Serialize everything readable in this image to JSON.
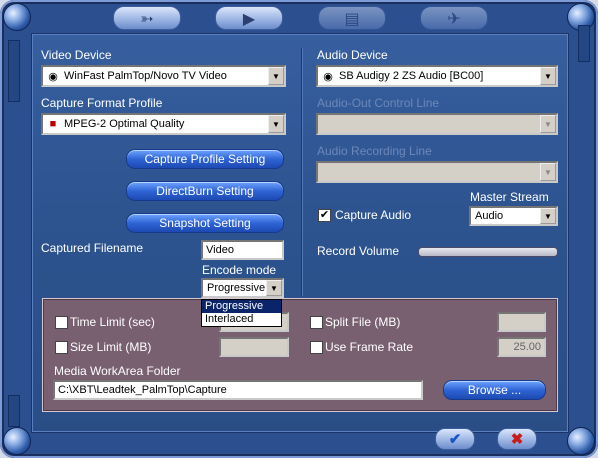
{
  "video": {
    "device_label": "Video Device",
    "device_value": "WinFast PalmTop/Novo TV Video",
    "format_label": "Capture Format Profile",
    "format_value": "MPEG-2 Optimal Quality",
    "btn_capture_profile": "Capture Profile Setting",
    "btn_directburn": "DirectBurn Setting",
    "btn_snapshot": "Snapshot Setting",
    "filename_label": "Captured Filename",
    "filename_value": "Video",
    "encode_label": "Encode mode",
    "encode_value": "Progressive",
    "encode_options": [
      "Progressive",
      "Interlaced"
    ]
  },
  "audio": {
    "device_label": "Audio Device",
    "device_value": "SB Audigy 2 ZS Audio [BC00]",
    "out_control_label": "Audio-Out Control Line",
    "recording_label": "Audio Recording Line",
    "master_stream_label": "Master Stream",
    "capture_audio_label": "Capture Audio",
    "capture_audio_checked": true,
    "master_stream_value": "Audio",
    "record_volume_label": "Record Volume"
  },
  "options": {
    "time_limit_label": "Time Limit (sec)",
    "size_limit_label": "Size Limit (MB)",
    "split_file_label": "Split File (MB)",
    "frame_rate_label": "Use Frame Rate",
    "frame_rate_value": "25.00",
    "workarea_label": "Media WorkArea Folder",
    "workarea_value": "C:\\XBT\\Leadtek_PalmTop\\Capture",
    "browse_label": "Browse ..."
  },
  "colors": {
    "frame": "#2c4f90",
    "panel": "#2d548f",
    "pill": "#2f64d6",
    "bottom_panel": "#786070",
    "selection": "#0a246a"
  },
  "icons": {
    "top_tabs": [
      "capture-tab-icon",
      "video-tab-icon",
      "disc-tab-icon",
      "tools-tab-icon"
    ],
    "ok": "checkmark-icon",
    "cancel": "x-icon"
  }
}
